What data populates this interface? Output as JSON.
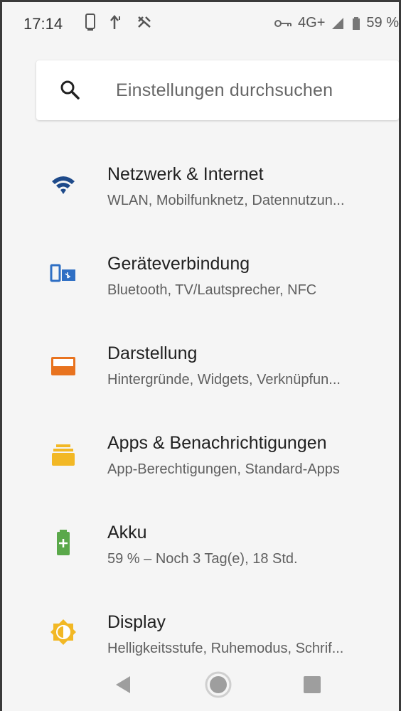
{
  "status_bar": {
    "time": "17:14",
    "network": "4G+",
    "battery": "59 %",
    "icons": [
      "phone-icon",
      "upload-icon",
      "cast-icon",
      "vpn-key-icon",
      "signal-icon",
      "battery-icon"
    ]
  },
  "search": {
    "placeholder": "Einstellungen durchsuchen",
    "icon": "search-icon"
  },
  "settings": [
    {
      "title": "Netzwerk & Internet",
      "subtitle": "WLAN, Mobilfunknetz, Datennutzun...",
      "icon": "wifi-icon",
      "color": "#1e4a8a"
    },
    {
      "title": "Geräteverbindung",
      "subtitle": "Bluetooth, TV/Lautsprecher, NFC",
      "icon": "devices-icon",
      "color": "#2f6fc4"
    },
    {
      "title": "Darstellung",
      "subtitle": "Hintergründe, Widgets, Verknüpfun...",
      "icon": "wallpaper-icon",
      "color": "#e8731f"
    },
    {
      "title": "Apps & Benachrichtigungen",
      "subtitle": "App-Berechtigungen, Standard-Apps",
      "icon": "apps-icon",
      "color": "#f2b825"
    },
    {
      "title": "Akku",
      "subtitle": "59 % – Noch 3 Tag(e), 18 Std.",
      "icon": "battery-icon",
      "color": "#5aa84a"
    },
    {
      "title": "Display",
      "subtitle": "Helligkeitsstufe, Ruhemodus, Schrif...",
      "icon": "brightness-icon",
      "color": "#f2b825"
    }
  ],
  "nav_bar": {
    "buttons": [
      "back-icon",
      "home-icon",
      "recents-icon"
    ]
  }
}
